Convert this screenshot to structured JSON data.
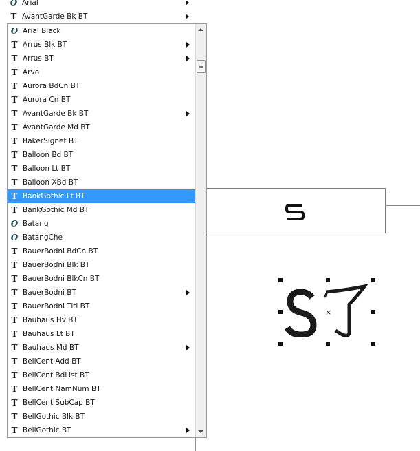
{
  "recent_fonts": [
    {
      "label": "Arial",
      "icon": "opentype-icon",
      "submenu": true
    },
    {
      "label": "AvantGarde Bk BT",
      "icon": "truetype-icon",
      "submenu": true
    }
  ],
  "font_list": [
    {
      "label": "Arial Black",
      "icon": "opentype-icon",
      "submenu": false
    },
    {
      "label": "Arrus Blk BT",
      "icon": "truetype-icon",
      "submenu": true
    },
    {
      "label": "Arrus BT",
      "icon": "truetype-icon",
      "submenu": true
    },
    {
      "label": "Arvo",
      "icon": "truetype-icon",
      "submenu": false
    },
    {
      "label": "Aurora BdCn BT",
      "icon": "truetype-icon",
      "submenu": false
    },
    {
      "label": "Aurora Cn BT",
      "icon": "truetype-icon",
      "submenu": false
    },
    {
      "label": "AvantGarde Bk BT",
      "icon": "truetype-icon",
      "submenu": true
    },
    {
      "label": "AvantGarde Md BT",
      "icon": "truetype-icon",
      "submenu": false
    },
    {
      "label": "BakerSignet BT",
      "icon": "truetype-icon",
      "submenu": false
    },
    {
      "label": "Balloon Bd BT",
      "icon": "truetype-icon",
      "submenu": false
    },
    {
      "label": "Balloon Lt BT",
      "icon": "truetype-icon",
      "submenu": false
    },
    {
      "label": "Balloon XBd BT",
      "icon": "truetype-icon",
      "submenu": false
    },
    {
      "label": "BankGothic Lt BT",
      "icon": "truetype-icon",
      "submenu": false,
      "selected": true
    },
    {
      "label": "BankGothic Md BT",
      "icon": "truetype-icon",
      "submenu": false
    },
    {
      "label": "Batang",
      "icon": "opentype-icon",
      "submenu": false
    },
    {
      "label": "BatangChe",
      "icon": "opentype-icon",
      "submenu": false
    },
    {
      "label": "BauerBodni BdCn BT",
      "icon": "truetype-icon",
      "submenu": false
    },
    {
      "label": "BauerBodni Blk BT",
      "icon": "truetype-icon",
      "submenu": false
    },
    {
      "label": "BauerBodni BlkCn BT",
      "icon": "truetype-icon",
      "submenu": false
    },
    {
      "label": "BauerBodni BT",
      "icon": "truetype-icon",
      "submenu": true
    },
    {
      "label": "BauerBodni Titl BT",
      "icon": "truetype-icon",
      "submenu": false
    },
    {
      "label": "Bauhaus Hv BT",
      "icon": "truetype-icon",
      "submenu": false
    },
    {
      "label": "Bauhaus Lt BT",
      "icon": "truetype-icon",
      "submenu": false
    },
    {
      "label": "Bauhaus Md BT",
      "icon": "truetype-icon",
      "submenu": true
    },
    {
      "label": "BellCent Add BT",
      "icon": "truetype-icon",
      "submenu": false
    },
    {
      "label": "BellCent BdList BT",
      "icon": "truetype-icon",
      "submenu": false
    },
    {
      "label": "BellCent NamNum BT",
      "icon": "truetype-icon",
      "submenu": false
    },
    {
      "label": "BellCent SubCap BT",
      "icon": "truetype-icon",
      "submenu": false
    },
    {
      "label": "BellGothic Blk BT",
      "icon": "truetype-icon",
      "submenu": false
    },
    {
      "label": "BellGothic BT",
      "icon": "truetype-icon",
      "submenu": true
    }
  ],
  "icon_glyphs": {
    "truetype-icon": "T",
    "opentype-icon": "O"
  },
  "colors": {
    "selection": "#3399ff",
    "opentype_icon": "#1d4f57"
  }
}
